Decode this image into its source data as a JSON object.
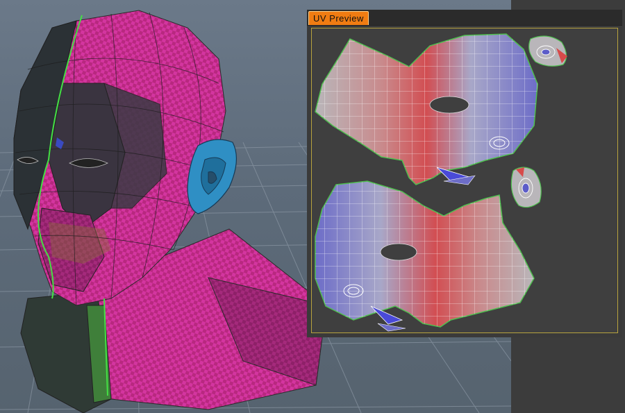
{
  "uv_preview": {
    "title": "UV Preview"
  },
  "colors": {
    "viewport_bg": "#5f6d7c",
    "mesh_magenta": "#c22a8c",
    "mesh_dark": "#2b3135",
    "ear_blue": "#2f8fc4",
    "seam_green": "#44e044",
    "uv_tab_orange": "#f07c12",
    "uv_border": "#b8a33e",
    "uv_red": "#d84a4a",
    "uv_blue": "#5c5cc8",
    "uv_neutral": "#b9b9bd"
  },
  "icons": {
    "viewport": "3d-mesh-viewport",
    "grid": "floor-grid"
  }
}
